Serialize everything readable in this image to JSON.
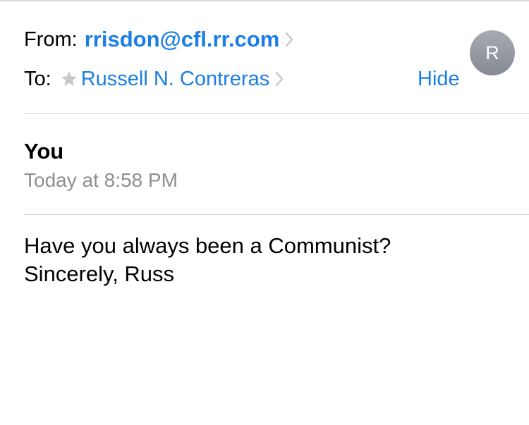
{
  "header": {
    "from_label": "From:",
    "from_address": "rrisdon@cfl.rr.com",
    "to_label": "To:",
    "to_name": "Russell N. Contreras",
    "hide_label": "Hide",
    "avatar_initial": "R"
  },
  "message": {
    "sender": "You",
    "timestamp": "Today at 8:58 PM",
    "body_lines": [
      "Have you always been a Communist?",
      "Sincerely, Russ"
    ]
  },
  "colors": {
    "accent": "#1a7ee6",
    "secondary_text": "#8e8e93",
    "avatar": "#9a9da5"
  },
  "icons": {
    "chevron": "chevron-right-icon",
    "star": "star-icon"
  }
}
